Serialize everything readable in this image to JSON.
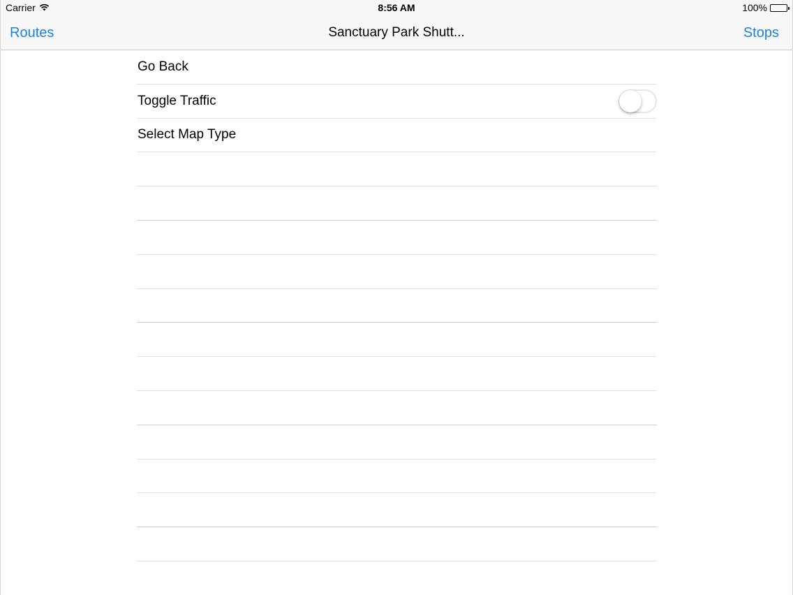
{
  "status_bar": {
    "carrier": "Carrier",
    "time": "8:56 AM",
    "battery_percent": "100%",
    "battery_level": 1.0
  },
  "nav_bar": {
    "left_button": "Routes",
    "title": "Sanctuary Park Shutt...",
    "right_button": "Stops",
    "tint_color": "#1a82e2"
  },
  "menu": {
    "items": [
      {
        "label": "Go Back"
      },
      {
        "label": "Toggle Traffic",
        "toggle_on": false
      },
      {
        "label": "Select Map Type"
      }
    ]
  }
}
